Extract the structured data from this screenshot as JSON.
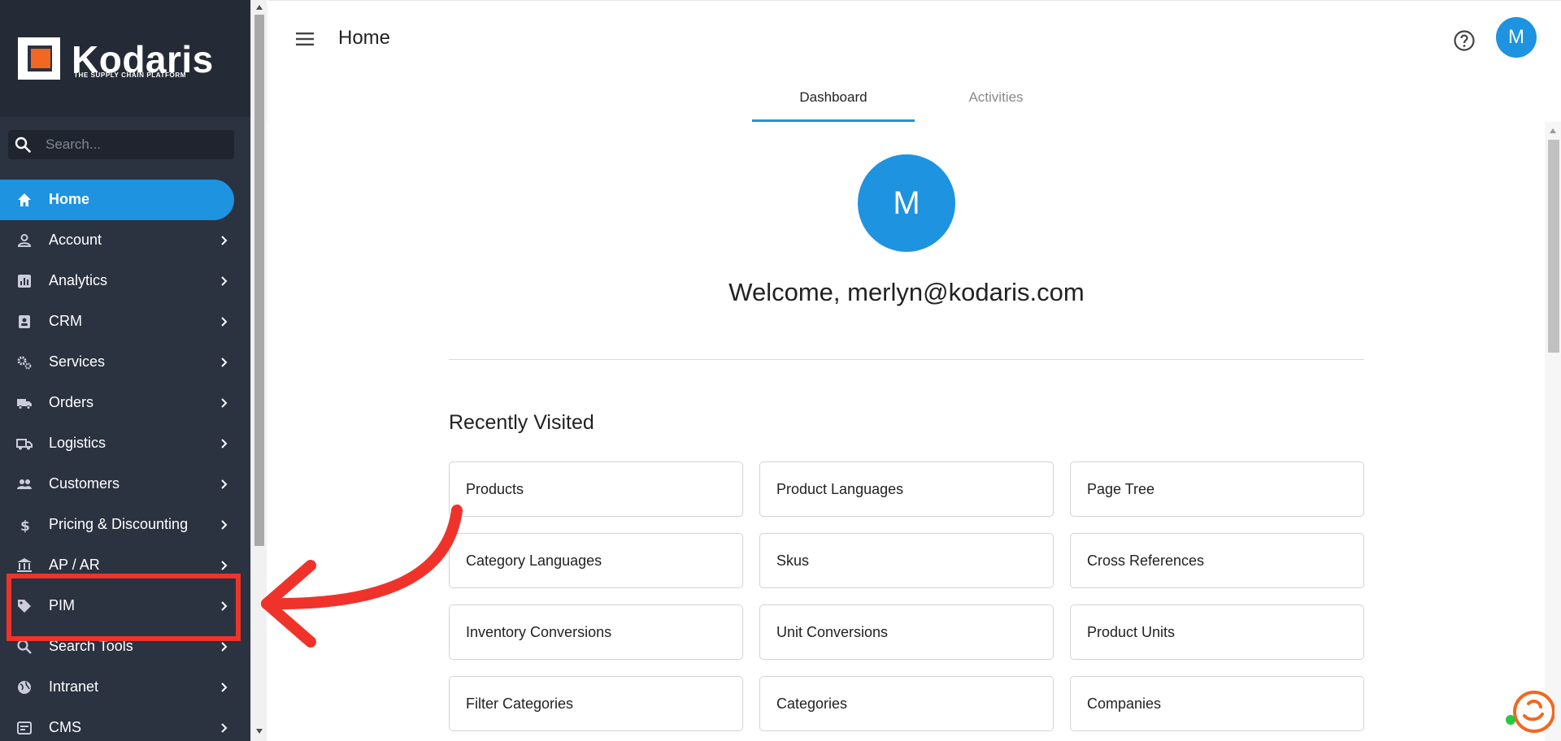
{
  "brand": {
    "name": "Kodaris",
    "tagline": "THE SUPPLY CHAIN PLATFORM",
    "accent": "#1e93e0",
    "logo_orange": "#f26722"
  },
  "search": {
    "placeholder": "Search..."
  },
  "sidebar": {
    "items": [
      {
        "label": "Home",
        "icon": "home-icon",
        "active": true,
        "chevron": false
      },
      {
        "label": "Account",
        "icon": "person-icon",
        "active": false,
        "chevron": true
      },
      {
        "label": "Analytics",
        "icon": "analytics-icon",
        "active": false,
        "chevron": true
      },
      {
        "label": "CRM",
        "icon": "contact-card-icon",
        "active": false,
        "chevron": true
      },
      {
        "label": "Services",
        "icon": "gears-icon",
        "active": false,
        "chevron": true
      },
      {
        "label": "Orders",
        "icon": "truck-icon",
        "active": false,
        "chevron": true
      },
      {
        "label": "Logistics",
        "icon": "delivery-truck-icon",
        "active": false,
        "chevron": true
      },
      {
        "label": "Customers",
        "icon": "people-icon",
        "active": false,
        "chevron": true
      },
      {
        "label": "Pricing & Discounting",
        "icon": "dollar-icon",
        "active": false,
        "chevron": true
      },
      {
        "label": "AP / AR",
        "icon": "bank-icon",
        "active": false,
        "chevron": true
      },
      {
        "label": "PIM",
        "icon": "tag-icon",
        "active": false,
        "chevron": true
      },
      {
        "label": "Search Tools",
        "icon": "search-icon",
        "active": false,
        "chevron": true
      },
      {
        "label": "Intranet",
        "icon": "globe-icon",
        "active": false,
        "chevron": true
      },
      {
        "label": "CMS",
        "icon": "cms-icon",
        "active": false,
        "chevron": true
      }
    ]
  },
  "header": {
    "title": "Home",
    "avatar_initial": "M"
  },
  "tabs": [
    {
      "label": "Dashboard",
      "active": true
    },
    {
      "label": "Activities",
      "active": false
    }
  ],
  "main": {
    "avatar_initial": "M",
    "welcome": "Welcome, merlyn@kodaris.com",
    "recently_visited_title": "Recently Visited",
    "recent": [
      "Products",
      "Product Languages",
      "Page Tree",
      "Category Languages",
      "Skus",
      "Cross References",
      "Inventory Conversions",
      "Unit Conversions",
      "Product Units",
      "Filter Categories",
      "Categories",
      "Companies"
    ]
  },
  "overlay": {
    "highlight_color": "#f0332a",
    "highlight_target": "PIM"
  }
}
